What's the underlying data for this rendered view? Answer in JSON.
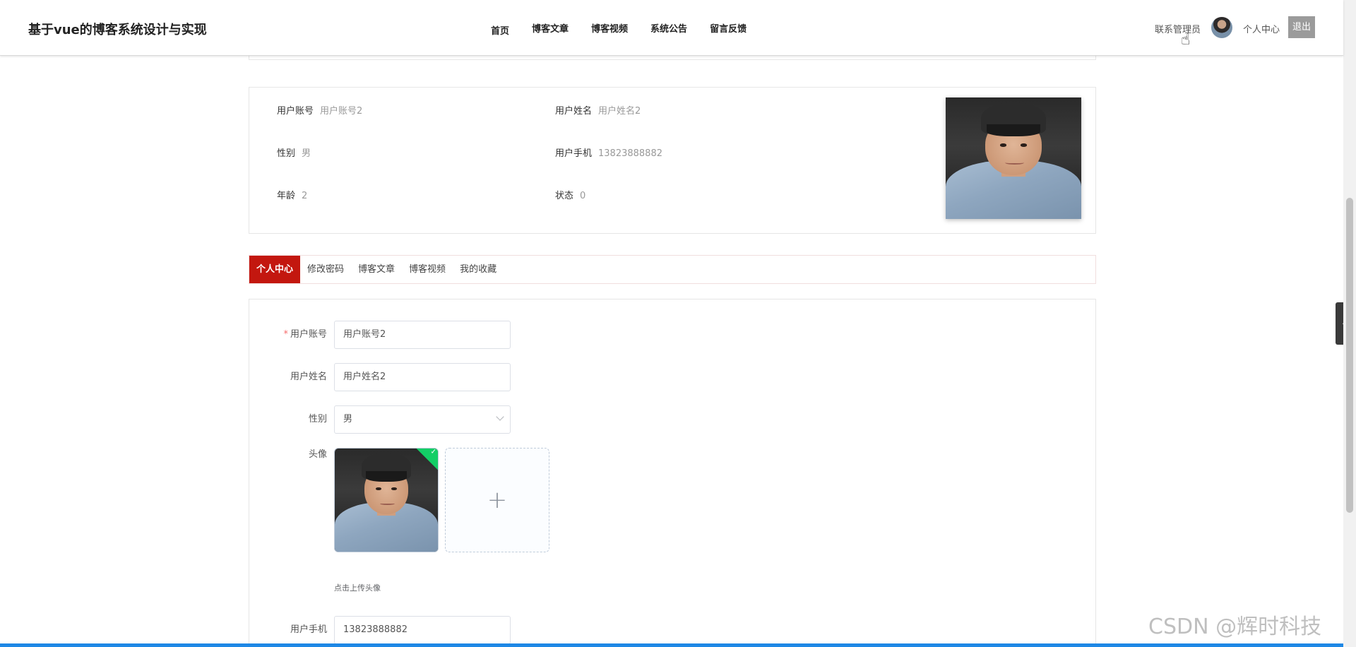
{
  "header": {
    "title": "基于vue的博客系统设计与实现",
    "nav": [
      "首页",
      "博客文章",
      "博客视频",
      "系统公告",
      "留言反馈"
    ],
    "contact_admin": "联系管理员",
    "user_center": "个人中心",
    "logout": "退出"
  },
  "profile": {
    "account_label": "用户账号",
    "account_value": "用户账号2",
    "name_label": "用户姓名",
    "name_value": "用户姓名2",
    "gender_label": "性别",
    "gender_value": "男",
    "phone_label": "用户手机",
    "phone_value": "13823888882",
    "age_label": "年龄",
    "age_value": "2",
    "status_label": "状态",
    "status_value": "0"
  },
  "tabs": [
    "个人中心",
    "修改密码",
    "博客文章",
    "博客视频",
    "我的收藏"
  ],
  "form": {
    "required_mark": "*",
    "account_label": "用户账号",
    "account_value": "用户账号2",
    "name_label": "用户姓名",
    "name_value": "用户姓名2",
    "gender_label": "性别",
    "gender_value": "男",
    "avatar_label": "头像",
    "upload_plus": "+",
    "upload_tip": "点击上传头像",
    "phone_label": "用户手机",
    "phone_value": "13823888882"
  },
  "watermark": "CSDN @辉时科技",
  "colors": {
    "active_tab": "#c3170f",
    "logout_bg": "#9b9b9b",
    "upload_success": "#13ce66",
    "required": "#f56c6c",
    "bottom_bar": "#1e88e5"
  }
}
